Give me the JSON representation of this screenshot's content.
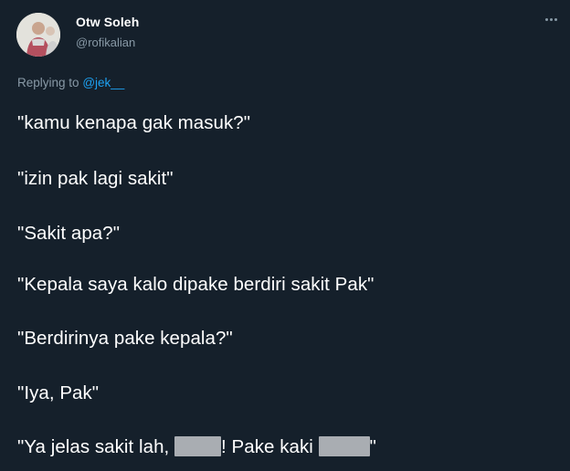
{
  "tweet": {
    "author": {
      "display_name": "Otw Soleh",
      "handle": "@rofikalian"
    },
    "more_icon": "more-horizontal-icon",
    "reply": {
      "prefix": "Replying to",
      "mention": "@jek__"
    },
    "lines": [
      "\"kamu kenapa gak masuk?\"",
      "\"izin pak lagi sakit\"",
      "\"Sakit apa?\"",
      "\"Kepala saya kalo dipake berdiri sakit Pak\"",
      "\"Berdirinya pake kepala?\"",
      "\"Iya, Pak\""
    ],
    "last_line": {
      "part1": "\"Ya jelas sakit lah,",
      "part2": "! Pake kaki",
      "part3": "\""
    }
  },
  "colors": {
    "background": "#15202b",
    "secondary_text": "#8899a6",
    "mention": "#1da1f2",
    "censor_block": "#a9adb2"
  }
}
